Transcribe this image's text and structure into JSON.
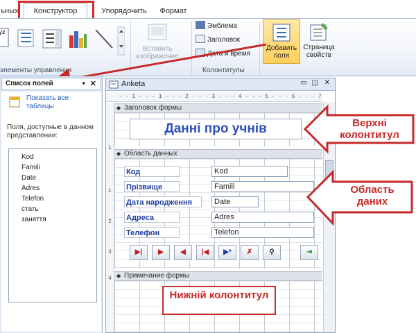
{
  "ribbon": {
    "tabs": [
      {
        "label": "ьных"
      },
      {
        "label": "Конструктор"
      },
      {
        "label": "Упорядочить"
      },
      {
        "label": "Формат"
      }
    ],
    "controls_group_label": "элементы управления",
    "insert_image_label": "Вставить изображение",
    "header_footer": {
      "emblem": "Эмблема",
      "title": "Заголовок",
      "date_time": "Дата и время",
      "group_label": "Колонтитулы"
    },
    "add_fields_label": "Добавить поля",
    "property_sheet_label": "Страница свойств"
  },
  "field_pane": {
    "title": "Список полей",
    "show_all_link": "Показать все таблицы",
    "note": "Поля, доступные в данном представлении:",
    "fields": [
      "Kod",
      "Famili",
      "Date",
      "Adres",
      "Telefon",
      "стать",
      "заняття"
    ]
  },
  "form": {
    "window_title": "Anketa",
    "ruler_text": "· · 1 · · · 1 · · · 2 · · · 3 · · · 4 · · · 5 · · · 6 · · · 7 · ·",
    "header_section_label": "Заголовок формы",
    "heading": "Данні про учнів",
    "detail_section_label": "Область данных",
    "footer_section_label": "Примечание формы",
    "rows": [
      {
        "label": "Код",
        "value": "Kod"
      },
      {
        "label": "Прізвище",
        "value": "Famili"
      },
      {
        "label": "Дата народження",
        "value": "Date"
      },
      {
        "label": "Адреса",
        "value": "Adres"
      },
      {
        "label": "Телефон",
        "value": "Telefon"
      }
    ]
  },
  "annotations": {
    "header": "Верхні колонтитул",
    "detail": "Область даних",
    "footer": "Нижній колонтитул"
  },
  "colors": {
    "annotation_red": "#c62a2a",
    "label_blue": "#1f3c9e",
    "ribbon_blue": "#9fb5d2"
  }
}
